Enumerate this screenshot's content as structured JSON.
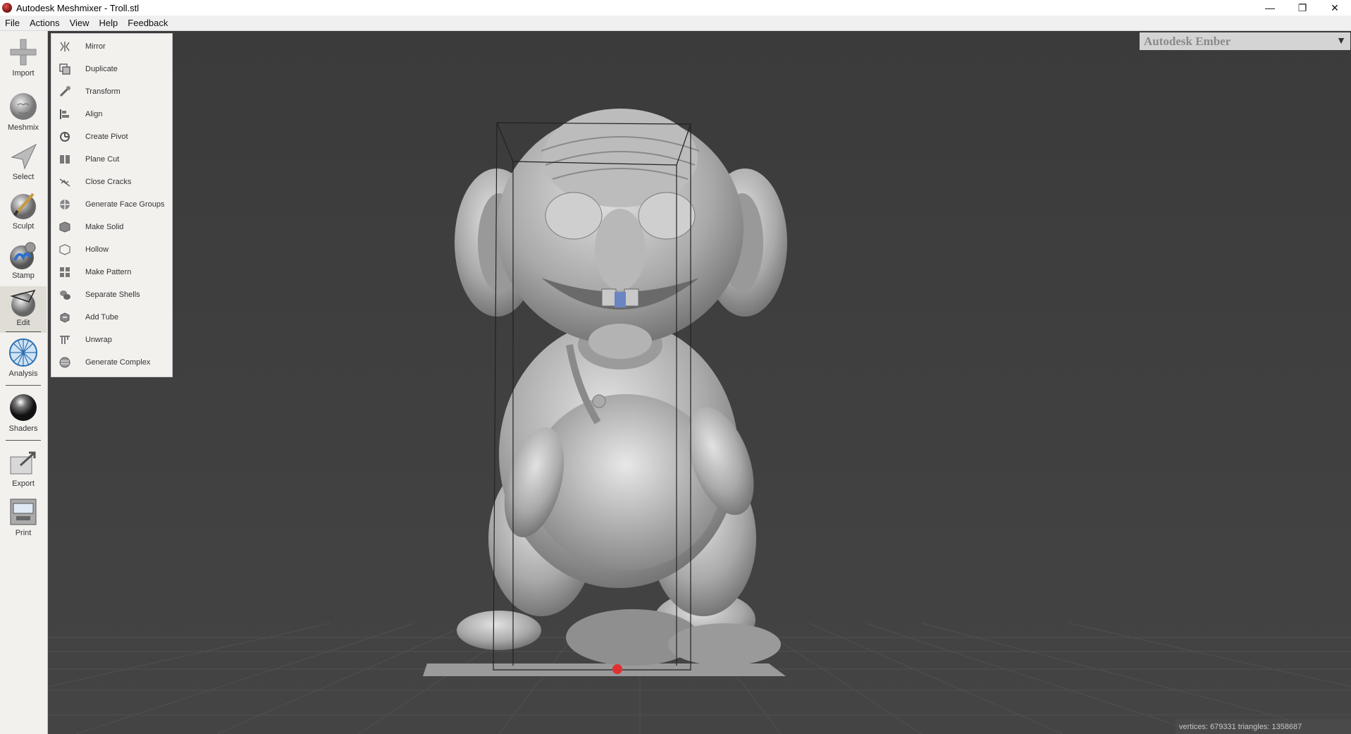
{
  "window": {
    "title": "Autodesk Meshmixer - Troll.stl",
    "minimize": "—",
    "maximize": "❐",
    "close": "✕"
  },
  "menubar": {
    "items": [
      "File",
      "Actions",
      "View",
      "Help",
      "Feedback"
    ]
  },
  "toolbar": {
    "items": [
      {
        "label": "Import",
        "icon": "plus-icon"
      },
      {
        "label": "Meshmix",
        "icon": "meshmix-icon"
      },
      {
        "label": "Select",
        "icon": "select-arrow-icon"
      },
      {
        "label": "Sculpt",
        "icon": "brush-icon"
      },
      {
        "label": "Stamp",
        "icon": "stamp-icon"
      },
      {
        "label": "Edit",
        "icon": "edit-icon"
      },
      {
        "label": "Analysis",
        "icon": "analysis-icon"
      },
      {
        "label": "Shaders",
        "icon": "shader-sphere-icon"
      },
      {
        "label": "Export",
        "icon": "export-icon"
      },
      {
        "label": "Print",
        "icon": "printer-icon"
      }
    ],
    "active": "Edit"
  },
  "edit_menu": {
    "items": [
      {
        "label": "Mirror",
        "icon": "mirror-icon"
      },
      {
        "label": "Duplicate",
        "icon": "duplicate-icon"
      },
      {
        "label": "Transform",
        "icon": "transform-icon"
      },
      {
        "label": "Align",
        "icon": "align-icon"
      },
      {
        "label": "Create Pivot",
        "icon": "pivot-icon"
      },
      {
        "label": "Plane Cut",
        "icon": "plane-cut-icon"
      },
      {
        "label": "Close Cracks",
        "icon": "close-cracks-icon"
      },
      {
        "label": "Generate Face Groups",
        "icon": "face-groups-icon"
      },
      {
        "label": "Make Solid",
        "icon": "make-solid-icon"
      },
      {
        "label": "Hollow",
        "icon": "hollow-icon"
      },
      {
        "label": "Make Pattern",
        "icon": "pattern-icon"
      },
      {
        "label": "Separate Shells",
        "icon": "separate-shells-icon"
      },
      {
        "label": "Add Tube",
        "icon": "tube-icon"
      },
      {
        "label": "Unwrap",
        "icon": "unwrap-icon"
      },
      {
        "label": "Generate Complex",
        "icon": "complex-icon"
      }
    ]
  },
  "ember_panel": {
    "title": "Autodesk Ember",
    "toggle": "▼"
  },
  "status": {
    "text": "vertices: 679331 triangles: 1358687"
  },
  "colors": {
    "viewport_bg": "#3d3d3d",
    "grid": "#555555",
    "model": "#bdbdbd",
    "pivot": "#e03030",
    "tooth_selection": "#6b85c2"
  }
}
